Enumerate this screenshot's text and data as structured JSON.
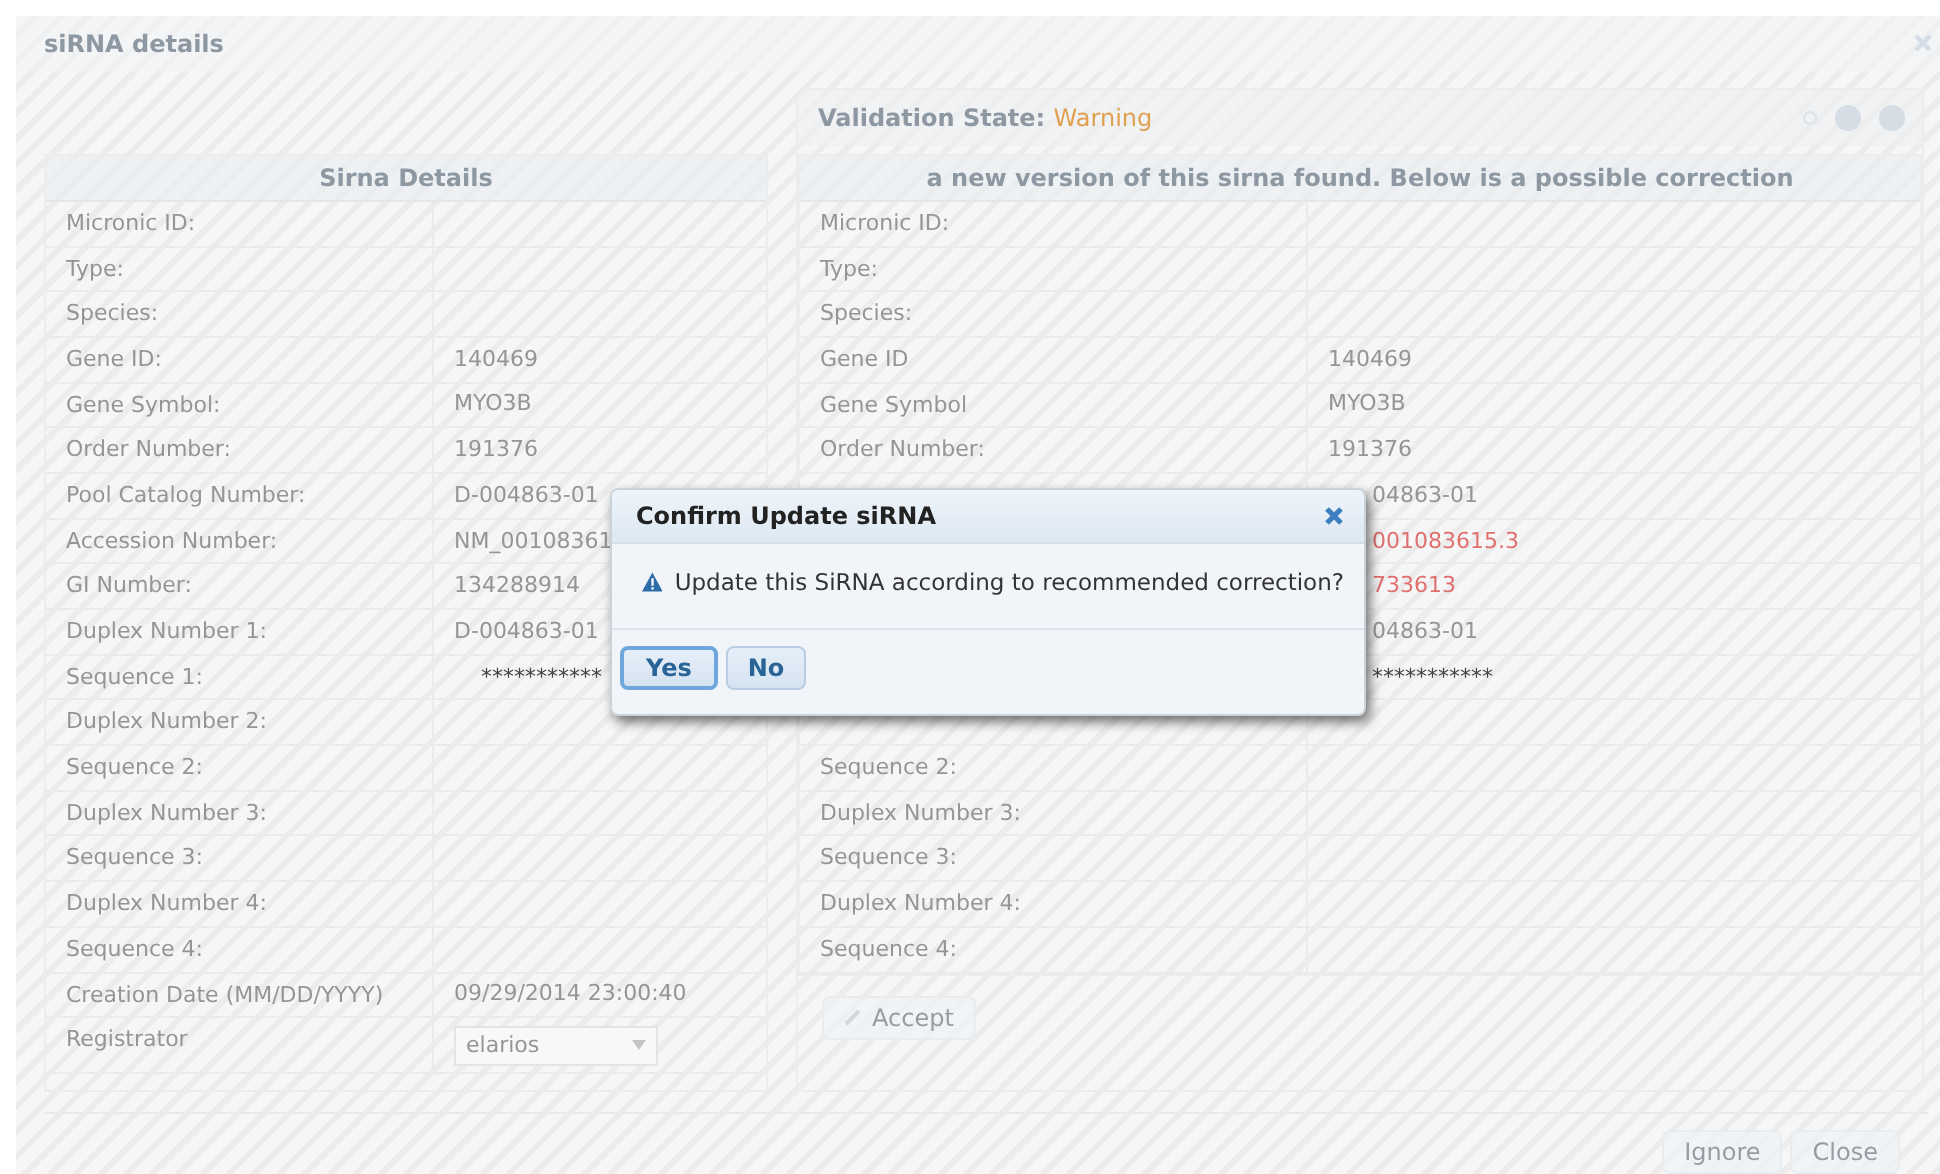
{
  "window": {
    "title": "siRNA details"
  },
  "sirna_details": {
    "title": "Sirna Details",
    "rows": [
      {
        "label": "Micronic ID:"
      },
      {
        "label": "Type:"
      },
      {
        "label": "Species:"
      },
      {
        "label": "Gene ID:",
        "value": "140469"
      },
      {
        "label": "Gene Symbol:",
        "value": "MYO3B"
      },
      {
        "label": "Order Number:",
        "value": "191376"
      },
      {
        "label": "Pool Catalog Number:",
        "value": "D-004863-01"
      },
      {
        "label": "Accession Number:",
        "value": "NM_00108361"
      },
      {
        "label": "GI Number:",
        "value": "134288914"
      },
      {
        "label": "Duplex Number 1:",
        "value": "D-004863-01"
      },
      {
        "label": "Sequence 1:",
        "value": "***********",
        "kind": "masked"
      },
      {
        "label": "Duplex Number 2:"
      },
      {
        "label": "Sequence 2:"
      },
      {
        "label": "Duplex Number 3:"
      },
      {
        "label": "Sequence 3:"
      },
      {
        "label": "Duplex Number 4:"
      },
      {
        "label": "Sequence 4:"
      },
      {
        "label": "Creation Date (MM/DD/YYYY)",
        "value": "09/29/2014 23:00:40"
      }
    ],
    "registrator": {
      "label": "Registrator",
      "value": "elarios"
    }
  },
  "validation": {
    "label": "Validation State:",
    "state": "Warning",
    "message": "a new version of this sirna found. Below is a possible correction",
    "rows": [
      {
        "label": "Micronic ID:"
      },
      {
        "label": "Type:"
      },
      {
        "label": "Species:"
      },
      {
        "label": "Gene ID",
        "value": "140469"
      },
      {
        "label": "Gene Symbol",
        "value": "MYO3B"
      },
      {
        "label": "Order Number:",
        "value": "191376"
      },
      {
        "value": "04863-01"
      },
      {
        "value": "001083615.3",
        "changed": true
      },
      {
        "value": "733613",
        "changed": true
      },
      {
        "value": "04863-01"
      },
      {
        "value": "***********",
        "kind": "masked"
      },
      {},
      {
        "label": "Sequence 2:"
      },
      {
        "label": "Duplex Number 3:"
      },
      {
        "label": "Sequence 3:"
      },
      {
        "label": "Duplex Number 4:"
      },
      {
        "label": "Sequence 4:"
      }
    ],
    "accept_button": "Accept"
  },
  "footer_buttons": [
    "Ignore",
    "Close"
  ],
  "confirm_dialog": {
    "title": "Confirm Update siRNA",
    "message": "Update this SiRNA according to recommended correction?",
    "buttons": [
      {
        "label": "Yes",
        "selected": true
      },
      {
        "label": "No",
        "selected": false
      }
    ]
  }
}
